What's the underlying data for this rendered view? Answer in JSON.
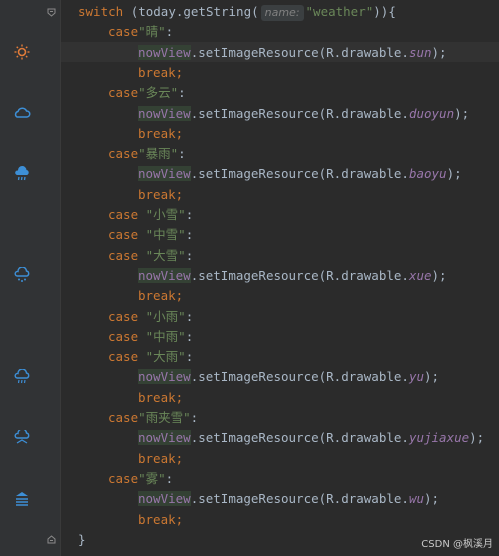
{
  "code": {
    "switch_kw": "switch",
    "switch_open": "(today.getString(",
    "param_hint": "name:",
    "switch_arg": "\"weather\"",
    "switch_close": ")){",
    "case_kw": "case",
    "break_stmt": "break;",
    "colon": ":",
    "view_var": "nowView",
    "method_call": ".setImageResource(R.drawable.",
    "method_end": ");",
    "closing_brace": "}",
    "cases": [
      {
        "label": "\"晴\"",
        "resource": "sun"
      },
      {
        "label": "\"多云\"",
        "resource": "duoyun"
      },
      {
        "label": "\"暴雨\"",
        "resource": "baoyu"
      },
      {
        "label": "\"小雪\""
      },
      {
        "label": "\"中雪\""
      },
      {
        "label": "\"大雪\"",
        "resource": "xue"
      },
      {
        "label": "\"小雨\""
      },
      {
        "label": "\"中雨\""
      },
      {
        "label": "\"大雨\"",
        "resource": "yu"
      },
      {
        "label": "\"雨夹雪\"",
        "resource": "yujiaxue"
      },
      {
        "label": "\"雾\"",
        "resource": "wu"
      }
    ]
  },
  "gutter_icons": [
    "sun-icon",
    "cloudy-icon",
    "rainstorm-icon",
    "snow-icon",
    "rain-icon",
    "sleet-icon",
    "fog-icon"
  ],
  "watermark": "CSDN @枫溪月",
  "colors": {
    "background": "#2b2b2b",
    "keyword": "#cc7832",
    "string": "#6a8759",
    "field": "#9876aa",
    "text": "#a9b7c6"
  }
}
